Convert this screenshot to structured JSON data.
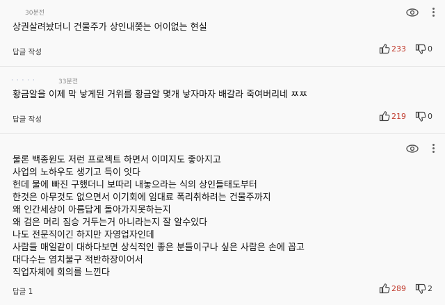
{
  "comments": [
    {
      "time": "30분전",
      "text": "상권살려놨더니 건물주가 상인내쫒는 어이없는 현실",
      "reply_label": "답글 작성",
      "likes": "233",
      "dislikes": "0"
    },
    {
      "time": "33분전",
      "text": "황금알을 이제 막 낳게된 거위를 황금알 몇개 낳자마자 배갈라 죽여버리네 ㅉㅉ",
      "reply_label": "답글 작성",
      "likes": "219",
      "dislikes": "0"
    },
    {
      "time": "",
      "text": "물론 백종원도 저런 프로젝트 하면서 이미지도 좋아지고\n사업의 노하우도 생기고 득이 잇다\n헌데 물에 빠진 구했더니 보따리 내놓으라는 식의 상인들태도부터\n한것은 아무것도 없으면서 이기회에 임대료 폭리취하려는 건물주까지\n왜 인간세상이 아름답게 돌아가지못하는지\n왜 검은 머리 짐승 거두는거 아니라는지 잘 알수있다\n나도 전문직이긴 하지만 자영업자인데\n사람들 매일같이 대하다보면 상식적인 좋은 분들이구나 싶은 사람은 손에 꼽고\n대다수는 염치불구 적반하장이어서\n직업자체에 회의를 느낀다",
      "reply_label": "답글",
      "reply_count": "1",
      "likes": "289",
      "dislikes": "2"
    }
  ],
  "colors": {
    "like_count": "#c0392b"
  }
}
